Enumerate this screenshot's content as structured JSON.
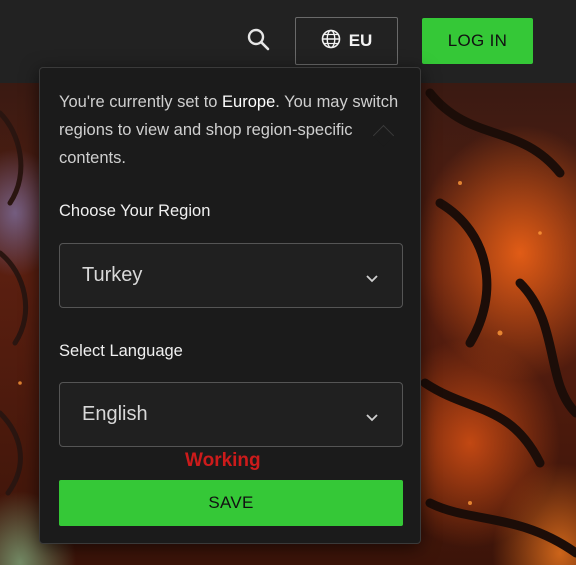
{
  "header": {
    "region_code": "EU",
    "login_label": "LOG IN",
    "icons": {
      "search": "search-icon",
      "region": "globe-icon"
    }
  },
  "region_popover": {
    "intro_prefix": "You're currently set to ",
    "intro_region": "Europe",
    "intro_suffix": ". You may switch regions to view and shop region-specific contents.",
    "region_label": "Choose Your Region",
    "region_value": "Turkey",
    "language_label": "Select Language",
    "language_value": "English",
    "status_text": "Working",
    "save_label": "SAVE"
  },
  "colors": {
    "accent_green": "#35c837",
    "status_red": "#cc1b1b",
    "panel_bg": "#1b1b1b",
    "topbar_bg": "#222222"
  }
}
